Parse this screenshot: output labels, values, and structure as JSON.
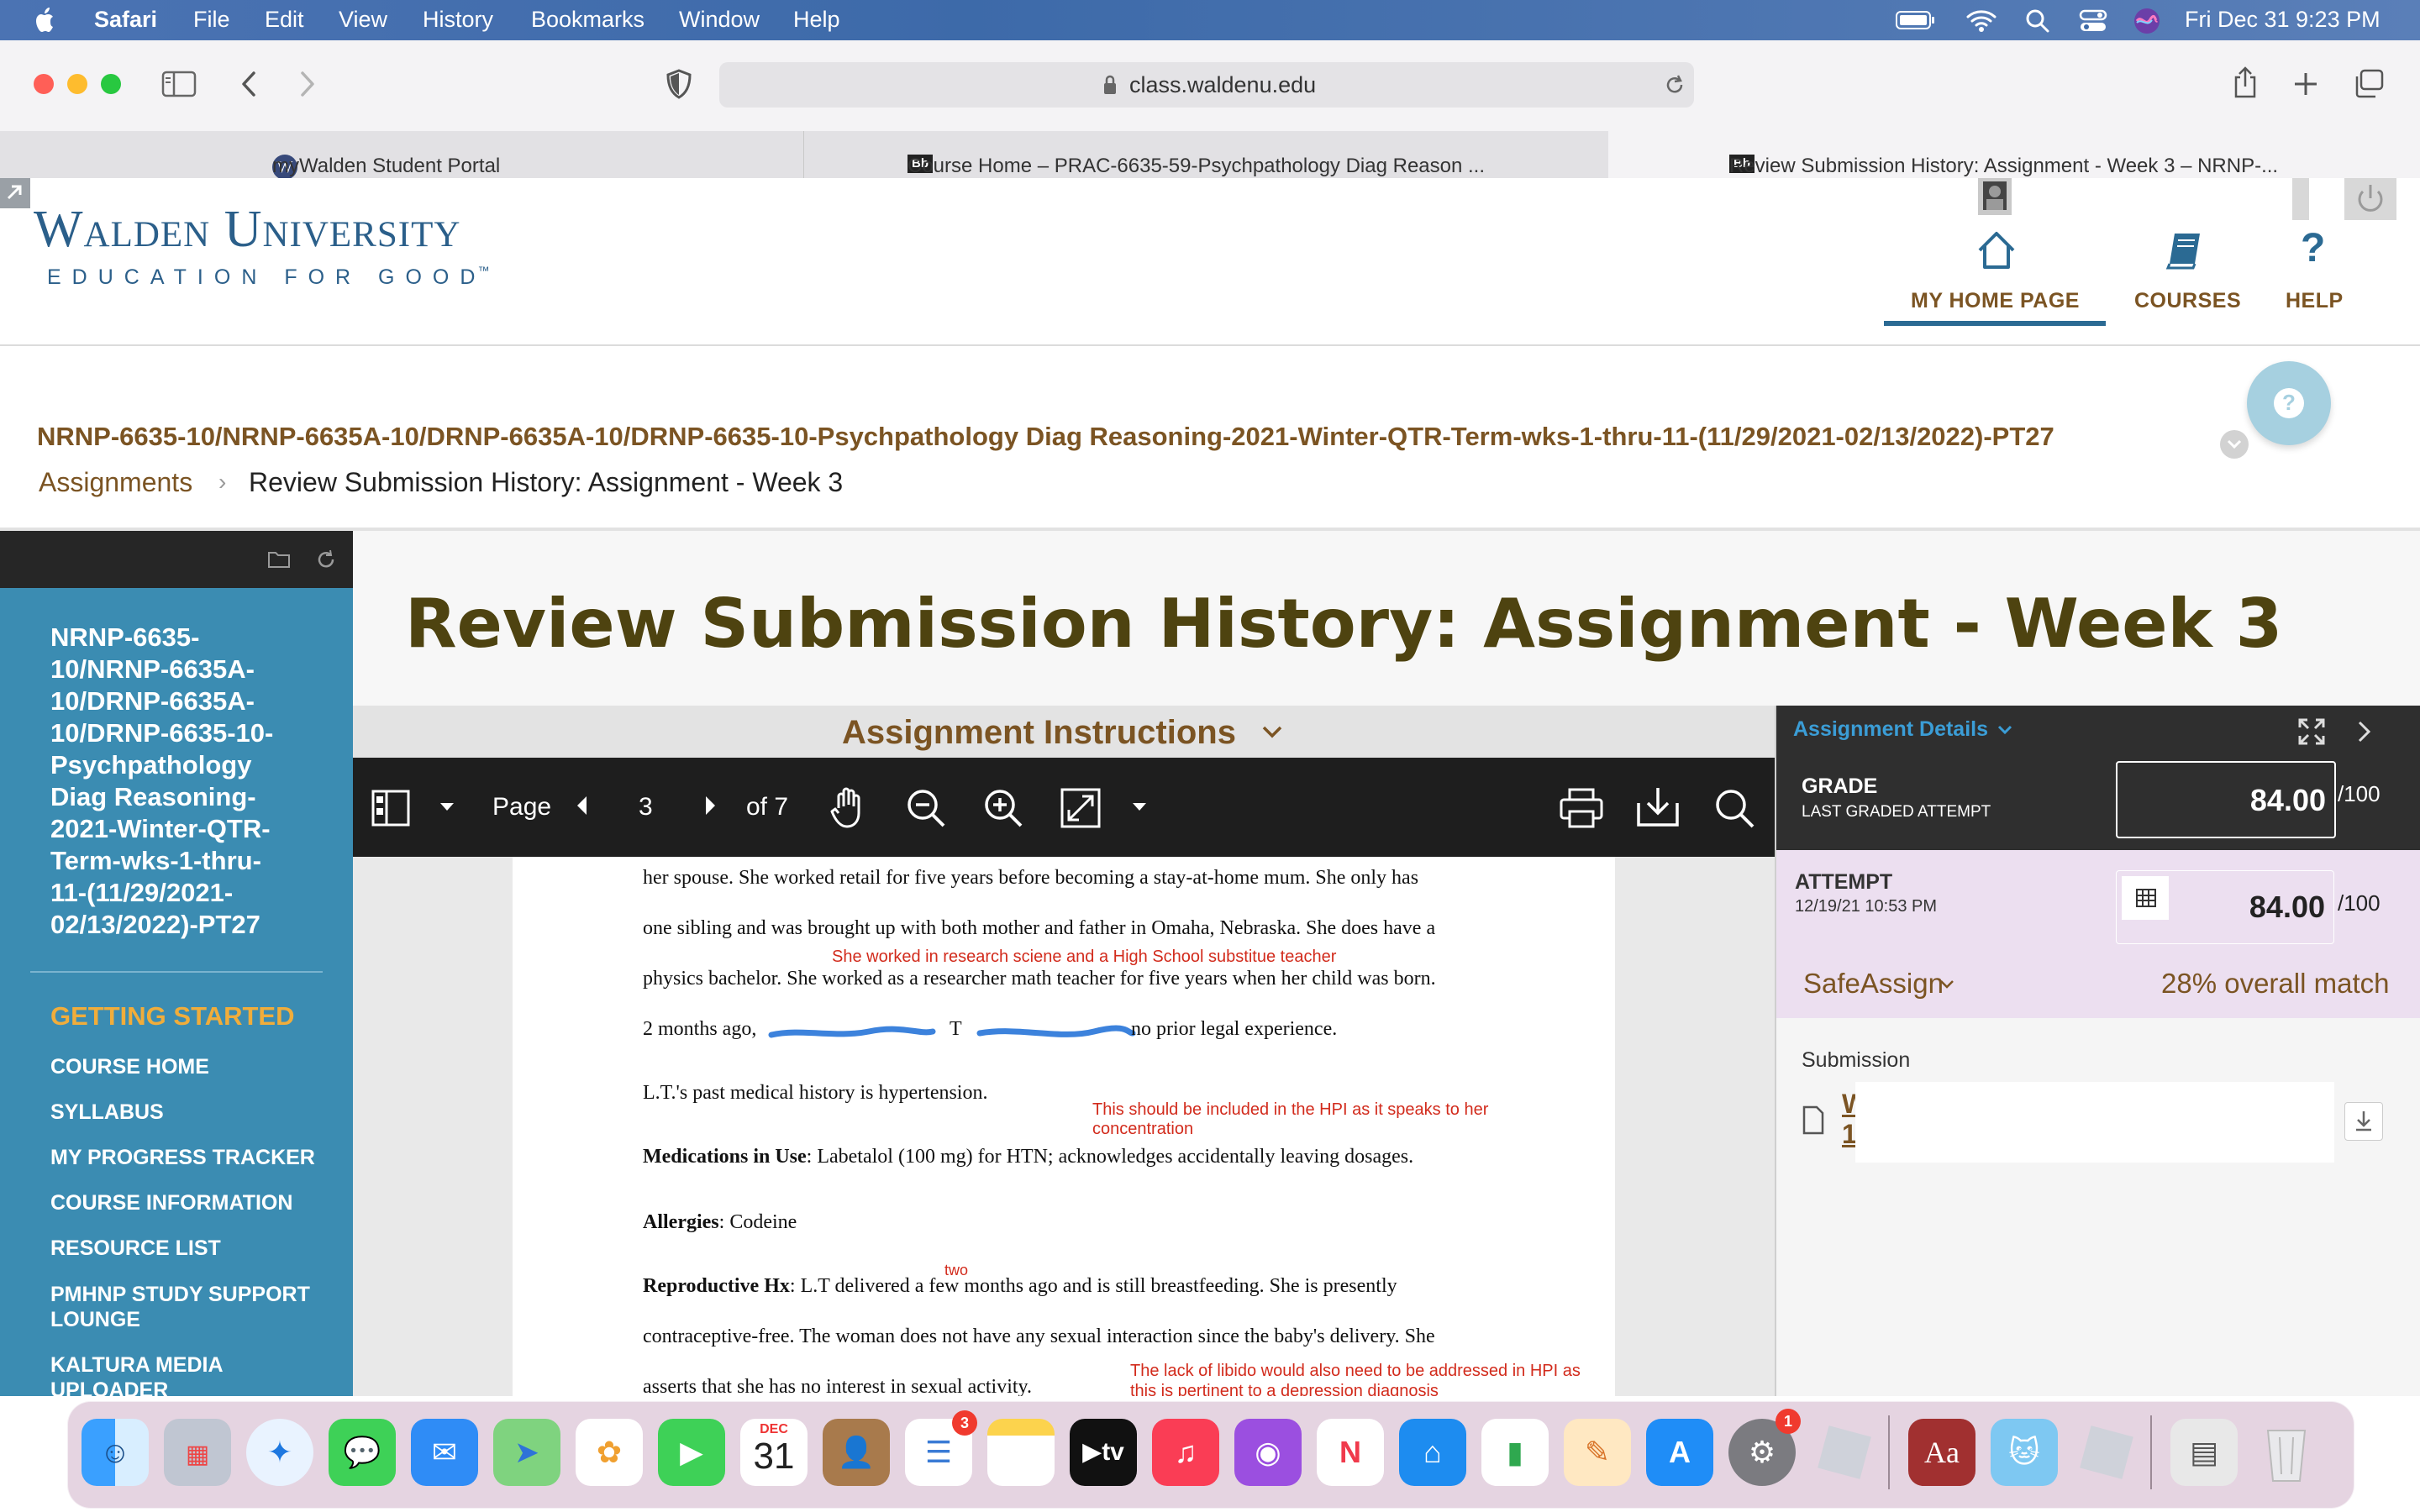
{
  "menubar": {
    "app": "Safari",
    "menus": [
      "File",
      "Edit",
      "View",
      "History",
      "Bookmarks",
      "Window",
      "Help"
    ],
    "clock": "Fri Dec 31  9:23 PM"
  },
  "browser": {
    "url": "class.waldenu.edu",
    "tabs": [
      {
        "label": "myWalden Student Portal"
      },
      {
        "label": "Course Home – PRAC-6635-59-Psychpathology Diag Reason ..."
      },
      {
        "label": "Review Submission History: Assignment - Week 3 – NRNP-..."
      }
    ]
  },
  "header": {
    "logo_line1": "Walden University",
    "logo_line2": "EDUCATION FOR GOOD",
    "logo_tm": "™",
    "nav": [
      {
        "label": "MY HOME PAGE",
        "icon": "home-icon"
      },
      {
        "label": "COURSES",
        "icon": "book-icon"
      },
      {
        "label": "HELP",
        "icon": "question-icon"
      }
    ]
  },
  "course_path": "NRNP-6635-10/NRNP-6635A-10/DRNP-6635A-10/DRNP-6635-10-Psychpathology Diag Reasoning-2021-Winter-QTR-Term-wks-1-thru-11-(11/29/2021-02/13/2022)-PT27",
  "breadcrumb": {
    "parent": "Assignments",
    "separator": "›",
    "current": "Review Submission History: Assignment - Week 3"
  },
  "sidebar": {
    "course_title": "NRNP-6635-10/NRNP-6635A-10/DRNP-6635A-10/DRNP-6635-10-Psychpathology Diag Reasoning-2021-Winter-QTR-Term-wks-1-thru-11-(11/29/2021-02/13/2022)-PT27",
    "course_title_lines": [
      "NRNP-6635-",
      "10/NRNP-6635A-",
      "10/DRNP-6635A-",
      "10/DRNP-6635-10-",
      "Psychpathology",
      "Diag Reasoning-",
      "2021-Winter-QTR-",
      "Term-wks-1-thru-",
      "11-(11/29/2021-",
      "02/13/2022)-PT27"
    ],
    "section_heading": "GETTING STARTED",
    "links": [
      "COURSE HOME",
      "SYLLABUS",
      "MY PROGRESS TRACKER",
      "COURSE INFORMATION",
      "RESOURCE LIST",
      "PMHNP STUDY SUPPORT LOUNGE",
      "KALTURA MEDIA UPLOADER"
    ]
  },
  "page_title": "Review Submission History: Assignment - Week 3",
  "instructions_label": "Assignment Instructions",
  "pdf_toolbar": {
    "page_label": "Page",
    "page_number": "3",
    "page_total": "of 7"
  },
  "pdf_content": {
    "lines": [
      "her spouse. She worked retail for five years before becoming a stay-at-home mum. She only has",
      "one sibling and was brought up with both mother and father in Omaha, Nebraska. She does have a",
      "physics bachelor. She worked as a researcher math teacher for five years when her child was born.",
      "no prior legal experience.",
      "L.T.'s past medical history is hypertension.",
      "Labetalol (100 mg) for HTN; acknowledges accidentally leaving dosages.",
      "Codeine",
      "L.T delivered a few months ago and is still breastfeeding. She is presently",
      "contraceptive-free. The woman does not have any sexual interaction since the baby's delivery. She",
      "asserts that she has no interest in sexual activity."
    ],
    "line4_prefix": "2 months ago, ",
    "bold_meds": "Medications in Use",
    "bold_allergies": "Allergies",
    "bold_repro": "Reproductive Hx",
    "notes": [
      "She worked in research sciene and a High School substitue teacher",
      "This should be included in the HPI as it speaks to her concentration",
      "two",
      "The lack of libido would also need to be addressed in HPI as this is pertinent to a depression diagnosis"
    ]
  },
  "details": {
    "header": "Assignment Details",
    "grade_label": "GRADE",
    "grade_sub": "LAST GRADED ATTEMPT",
    "grade_value": "84.00",
    "grade_out_of": "/100",
    "attempt_label": "ATTEMPT",
    "attempt_date": "12/19/21 10:53 PM",
    "attempt_value": "84.00",
    "attempt_out_of": "/100",
    "safeassign_label": "SafeAssign",
    "match_text": "28% overall match",
    "submission_label": "Submission",
    "submission_file_chars": [
      "W",
      "1"
    ]
  },
  "dock": {
    "calendar_month": "DEC",
    "calendar_day": "31",
    "reminders_badge": "3",
    "settings_badge": "1",
    "tv_label": "tv",
    "dictionary_label": "Aa"
  },
  "colors": {
    "accent_brown": "#7b5423",
    "sidebar_blue": "#3b8cb2",
    "title_olive": "#4e4310",
    "annotation_red": "#d22b1c",
    "getting_started_gold": "#f0ad3b",
    "attempt_bg": "#ecdff0"
  }
}
